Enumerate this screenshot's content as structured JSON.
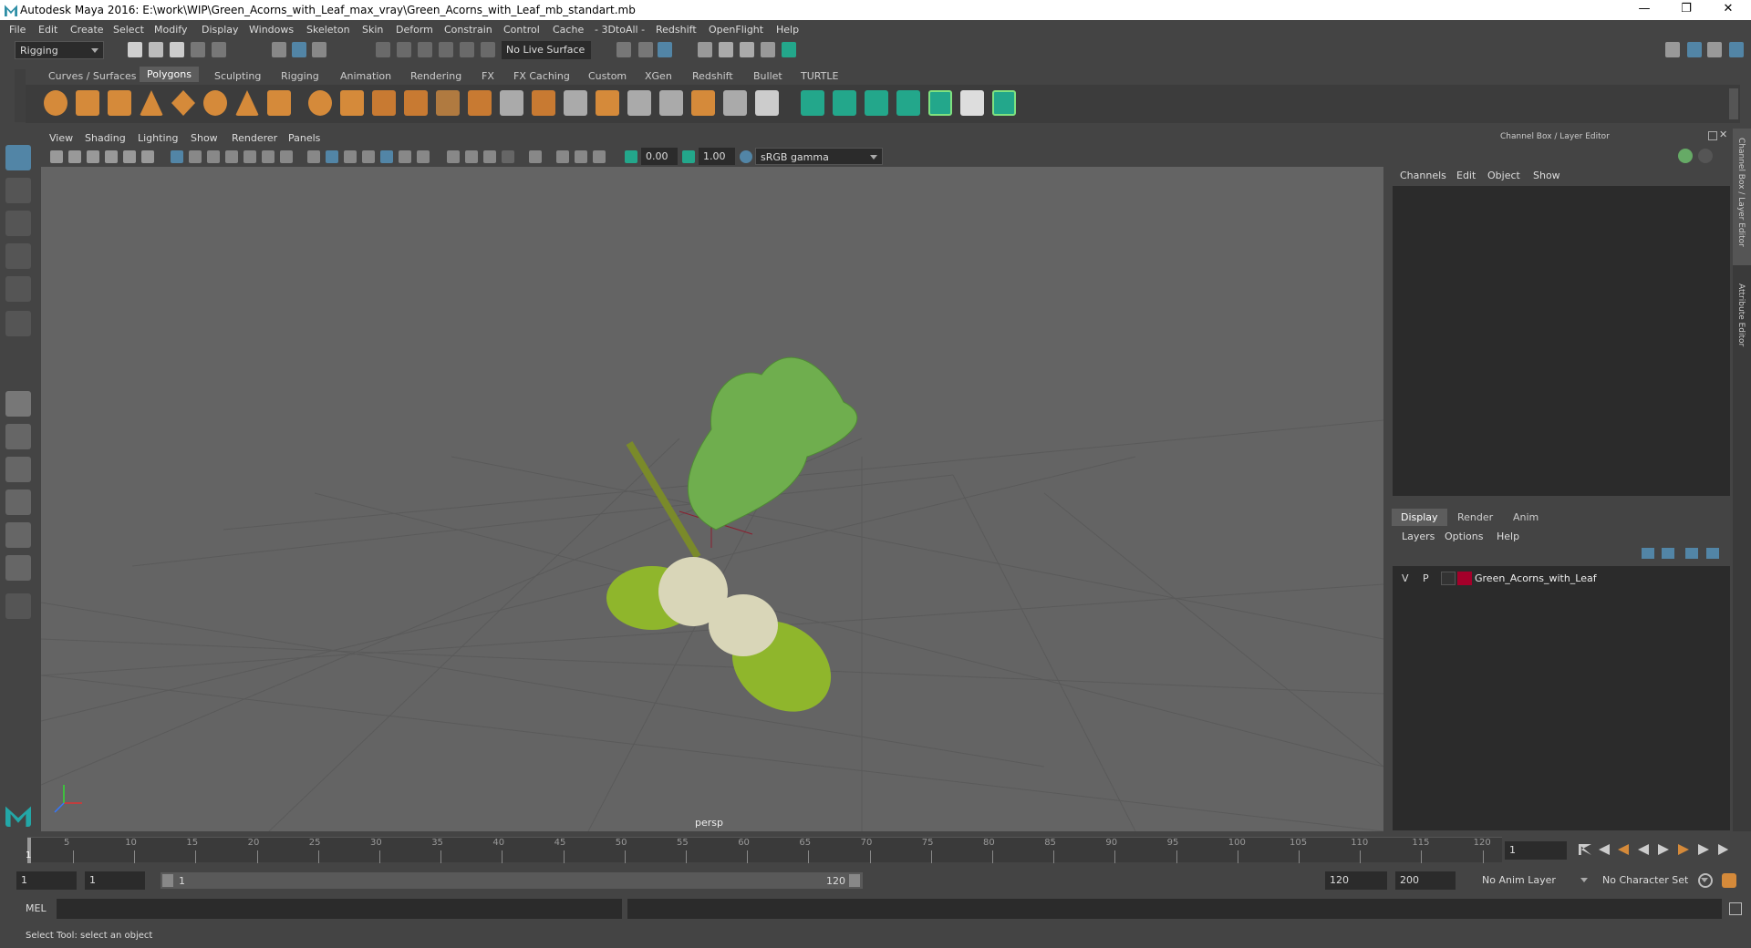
{
  "window": {
    "title": "Autodesk Maya 2016: E:\\work\\WIP\\Green_Acorns_with_Leaf_max_vray\\Green_Acorns_with_Leaf_mb_standart.mb",
    "minimize": "—",
    "restore": "❐",
    "close": "✕"
  },
  "menubar": [
    "File",
    "Edit",
    "Create",
    "Select",
    "Modify",
    "Display",
    "Windows",
    "Skeleton",
    "Skin",
    "Deform",
    "Constrain",
    "Control",
    "Cache",
    "- 3DtoAll -",
    "Redshift",
    "OpenFlight",
    "Help"
  ],
  "statusline": {
    "mode": "Rigging",
    "live_surface": "No Live Surface"
  },
  "shelf": {
    "tabs": [
      "Curves / Surfaces",
      "Polygons",
      "Sculpting",
      "Rigging",
      "Animation",
      "Rendering",
      "FX",
      "FX Caching",
      "Custom",
      "XGen",
      "Redshift",
      "Bullet",
      "TURTLE"
    ],
    "active_tab": "Polygons"
  },
  "viewport": {
    "menu": [
      "View",
      "Shading",
      "Lighting",
      "Show",
      "Renderer",
      "Panels"
    ],
    "exposure": "0.00",
    "gamma": "1.00",
    "colorspace": "sRGB gamma",
    "camera": "persp"
  },
  "channel_box": {
    "title": "Channel Box / Layer Editor",
    "menu": [
      "Channels",
      "Edit",
      "Object",
      "Show"
    ]
  },
  "layer_editor": {
    "tabs": [
      "Display",
      "Render",
      "Anim"
    ],
    "active_tab": "Display",
    "menu": [
      "Layers",
      "Options",
      "Help"
    ],
    "layers": [
      {
        "v": "V",
        "p": "P",
        "color": "#a4002a",
        "name": "Green_Acorns_with_Leaf"
      }
    ]
  },
  "side_tabs": [
    "Channel Box / Layer Editor",
    "Attribute Editor"
  ],
  "timeline": {
    "ticks": [
      "5",
      "10",
      "15",
      "20",
      "25",
      "30",
      "35",
      "40",
      "45",
      "50",
      "55",
      "60",
      "65",
      "70",
      "75",
      "80",
      "85",
      "90",
      "95",
      "100",
      "105",
      "110",
      "115",
      "120"
    ],
    "current_marker": "1",
    "current_frame": "1"
  },
  "range": {
    "start": "1",
    "playback_start": "1",
    "slider_start": "1",
    "slider_end": "120",
    "playback_end": "120",
    "end": "200",
    "anim_layer": "No Anim Layer",
    "character_set": "No Character Set"
  },
  "command": {
    "label": "MEL"
  },
  "help": {
    "text": "Select Tool: select an object"
  },
  "colors": {
    "ui_bg": "#444444",
    "viewport_bg": "#646464",
    "accent": "#5285a6",
    "shelf_green": "#23a78b",
    "leaf": "#6fae4e",
    "acorn": "#8fb62c"
  }
}
